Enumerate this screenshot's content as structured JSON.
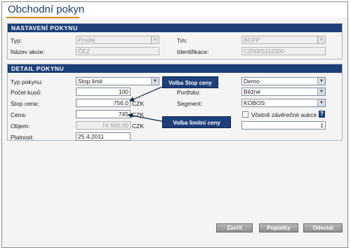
{
  "window": {
    "title": "Obchodní pokyn"
  },
  "settings": {
    "header": "NASTAVENÍ POKYNU",
    "typ_label": "Typ:",
    "typ_value": "Prodej",
    "nazev_label": "Název akcie:",
    "nazev_value": "ČEZ",
    "trh_label": "Trh:",
    "trh_value": "BCPP",
    "ident_label": "Identifikace:",
    "ident_value": "CZ0005112300"
  },
  "detail": {
    "header": "DETAIL POKYNU",
    "typ_pokynu_label": "Typ pokynu:",
    "typ_pokynu_value": "Stop limit",
    "pocet_label": "Počet kusů:",
    "pocet_value": "100",
    "stop_label": "Stop cena:",
    "stop_value": "756,0",
    "stop_unit": "CZK",
    "cena_label": "Cena:",
    "cena_value": "745",
    "cena_unit": "CZK",
    "objem_label": "Objem:",
    "objem_value": "74 500,00",
    "objem_unit": "CZK",
    "platnost_label": "Platnost:",
    "platnost_value": "25.4.2011",
    "account_value": "Demo",
    "portfolio_label": "Portfolio:",
    "portfolio_value": "Běžné",
    "segment_label": "Segment:",
    "segment_value": "KOBOS",
    "aukce_label": "Včetně závěrečné aukce",
    "help_glyph": "?",
    "aukce_count": "1"
  },
  "callouts": {
    "stop": "Volba Stop ceny",
    "limit": "Volba limitní ceny"
  },
  "buttons": {
    "close": "Zavřít",
    "fees": "Poplatky",
    "send": "Odeslat"
  },
  "colors": {
    "header_bg": "#1d3f7a",
    "title_underline": "#e88a1a",
    "title_text": "#1d3f6e"
  }
}
